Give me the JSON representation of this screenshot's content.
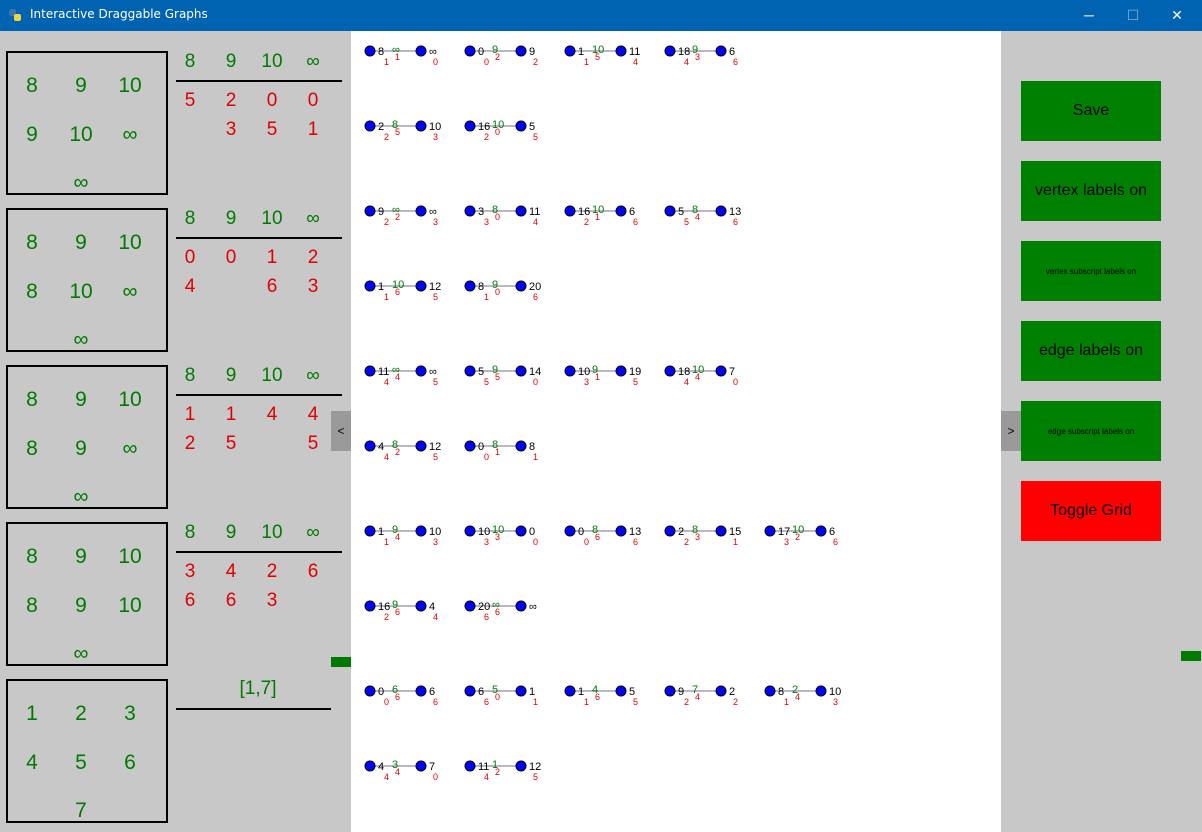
{
  "window": {
    "title": "Interactive Draggable Graphs",
    "controls": [
      "─",
      "☐",
      "✕"
    ]
  },
  "left": {
    "rows": [
      {
        "grid": [
          "8",
          "9",
          "10",
          "9",
          "10",
          "∞",
          "∞"
        ],
        "header": [
          "8",
          "9",
          "10",
          "∞"
        ],
        "row1": [
          "5",
          "2",
          "0",
          "0"
        ],
        "row2": [
          "",
          "3",
          "5",
          "1"
        ]
      },
      {
        "grid": [
          "8",
          "9",
          "10",
          "8",
          "10",
          "∞",
          "∞"
        ],
        "header": [
          "8",
          "9",
          "10",
          "∞"
        ],
        "row1": [
          "0",
          "0",
          "1",
          "2"
        ],
        "row2": [
          "4",
          "",
          "6",
          "3"
        ]
      },
      {
        "grid": [
          "8",
          "9",
          "10",
          "8",
          "9",
          "∞",
          "∞"
        ],
        "header": [
          "8",
          "9",
          "10",
          "∞"
        ],
        "row1": [
          "1",
          "1",
          "4",
          "4"
        ],
        "row2": [
          "2",
          "5",
          "",
          "5"
        ]
      },
      {
        "grid": [
          "8",
          "9",
          "10",
          "8",
          "9",
          "10",
          "∞"
        ],
        "header": [
          "8",
          "9",
          "10",
          "∞"
        ],
        "row1": [
          "3",
          "4",
          "2",
          "6"
        ],
        "row2": [
          "6",
          "6",
          "3",
          ""
        ]
      }
    ],
    "last": {
      "grid": [
        "1",
        "2",
        "3",
        "4",
        "5",
        "6",
        "7"
      ],
      "label": "[1,7]"
    },
    "collapse_label": "<"
  },
  "right": {
    "collapse_label": ">",
    "buttons": [
      {
        "label": "Save",
        "color": "#008000"
      },
      {
        "label": "vertex labels on",
        "color": "#008000"
      },
      {
        "label": "vertex subscript labels on",
        "color": "#008000"
      },
      {
        "label": "edge labels on",
        "color": "#008000"
      },
      {
        "label": "edge subscript labels on",
        "color": "#008000"
      },
      {
        "label": "Toggle Grid",
        "color": "#ff0000"
      }
    ]
  },
  "graphs": [
    [
      [
        [
          "8",
          "1",
          "∞",
          "1",
          "∞",
          "0"
        ],
        [
          "0",
          "0",
          "9",
          "2",
          "9",
          "2"
        ],
        [
          "1",
          "1",
          "10",
          "5",
          "11",
          "4"
        ],
        [
          "18",
          "4",
          "9",
          "3",
          "6",
          "6"
        ]
      ],
      [
        [
          "2",
          "2",
          "8",
          "5",
          "10",
          "3"
        ],
        [
          "16",
          "2",
          "10",
          "0",
          "5",
          "5"
        ]
      ]
    ],
    [
      [
        [
          "9",
          "2",
          "∞",
          "2",
          "∞",
          "3"
        ],
        [
          "3",
          "3",
          "8",
          "0",
          "11",
          "4"
        ],
        [
          "16",
          "2",
          "10",
          "1",
          "6",
          "6"
        ],
        [
          "5",
          "5",
          "8",
          "4",
          "13",
          "6"
        ]
      ],
      [
        [
          "1",
          "1",
          "10",
          "6",
          "12",
          "5"
        ],
        [
          "8",
          "1",
          "9",
          "0",
          "20",
          "6"
        ]
      ]
    ],
    [
      [
        [
          "11",
          "4",
          "∞",
          "4",
          "∞",
          "5"
        ],
        [
          "5",
          "5",
          "9",
          "5",
          "14",
          "0"
        ],
        [
          "10",
          "3",
          "9",
          "1",
          "19",
          "5"
        ],
        [
          "18",
          "4",
          "10",
          "4",
          "7",
          "0"
        ]
      ],
      [
        [
          "4",
          "4",
          "8",
          "2",
          "12",
          "5"
        ],
        [
          "0",
          "0",
          "8",
          "1",
          "8",
          "1"
        ]
      ]
    ],
    [
      [
        [
          "1",
          "1",
          "9",
          "4",
          "10",
          "3"
        ],
        [
          "10",
          "3",
          "10",
          "3",
          "0",
          "0"
        ],
        [
          "0",
          "0",
          "8",
          "6",
          "13",
          "6"
        ],
        [
          "2",
          "2",
          "8",
          "3",
          "15",
          "1"
        ],
        [
          "17",
          "3",
          "10",
          "2",
          "6",
          "6"
        ]
      ],
      [
        [
          "16",
          "2",
          "9",
          "6",
          "4",
          "4"
        ],
        [
          "20",
          "6",
          "∞",
          "6",
          "∞",
          ""
        ]
      ]
    ],
    [
      [
        [
          "0",
          "0",
          "6",
          "6",
          "6",
          "6"
        ],
        [
          "6",
          "6",
          "5",
          "0",
          "1",
          "1"
        ],
        [
          "1",
          "1",
          "4",
          "6",
          "5",
          "5"
        ],
        [
          "9",
          "2",
          "7",
          "4",
          "2",
          "2"
        ],
        [
          "8",
          "1",
          "2",
          "4",
          "10",
          "3"
        ]
      ],
      [
        [
          "4",
          "4",
          "3",
          "4",
          "7",
          "0"
        ],
        [
          "11",
          "4",
          "1",
          "2",
          "12",
          "5"
        ]
      ]
    ]
  ]
}
